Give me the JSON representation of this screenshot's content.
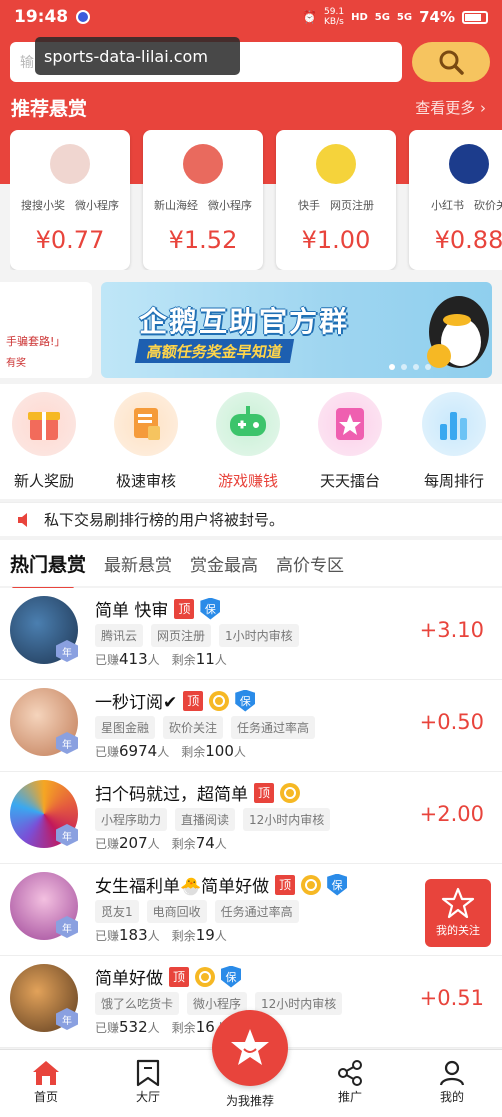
{
  "status": {
    "time": "19:48",
    "net_speed_top": "59.1",
    "net_speed_unit": "KB/s",
    "hd": "HD",
    "sig1": "5G",
    "sig2": "5G",
    "battery": "74%"
  },
  "watermark": "sports-data-lilai.com",
  "search": {
    "placeholder": "输"
  },
  "recommend": {
    "title": "推荐悬赏",
    "more": "查看更多 ›",
    "cards": [
      {
        "tag1": "搜搜小奖",
        "tag2": "微小程序",
        "price": "¥0.77",
        "avatar_color": "#f0d6d0"
      },
      {
        "tag1": "新山海经",
        "tag2": "微小程序",
        "price": "¥1.52",
        "avatar_color": "#e96a5e"
      },
      {
        "tag1": "快手",
        "tag2": "网页注册",
        "price": "¥1.00",
        "avatar_color": "#f5d33b"
      },
      {
        "tag1": "小红书",
        "tag2": "砍价关",
        "price": "¥0.88",
        "avatar_color": "#1c3c8c"
      }
    ]
  },
  "banner": {
    "left_line1": "手骗套路!」",
    "left_line2": "有奖",
    "title": "企鹅互助官方群",
    "subtitle": "高额任务奖金早知道"
  },
  "quick": [
    {
      "label": "新人奖励",
      "color": "#f26b5b"
    },
    {
      "label": "极速审核",
      "color": "#f59b3a"
    },
    {
      "label": "游戏赚钱",
      "color": "#3cc46b"
    },
    {
      "label": "天天擂台",
      "color": "#ef5fb0"
    },
    {
      "label": "每周排行",
      "color": "#3aa8f0"
    }
  ],
  "notice": "私下交易刷排行榜的用户将被封号。",
  "tabs": [
    "热门悬赏",
    "最新悬赏",
    "赏金最高",
    "高价专区"
  ],
  "tasks": [
    {
      "title": "简单 快审",
      "badges": [
        "ding",
        "bao"
      ],
      "tags": [
        "腾讯云",
        "网页注册",
        "1小时内审核"
      ],
      "earned_label": "已赚",
      "earned": "413",
      "people": "人",
      "left_label": "剩余",
      "left": "11",
      "reward": "+3.10",
      "year": "年",
      "avatar_color": "#2a4f7a"
    },
    {
      "title": "一秒订阅✔",
      "badges": [
        "ding",
        "coin",
        "bao"
      ],
      "tags": [
        "星图金融",
        "砍价关注",
        "任务通过率高"
      ],
      "earned_label": "已赚",
      "earned": "6974",
      "people": "人",
      "left_label": "剩余",
      "left": "100",
      "reward": "+0.50",
      "year": "年",
      "avatar_color": "#e8b89a"
    },
    {
      "title": "扫个码就过，超简单",
      "badges": [
        "ding",
        "coin"
      ],
      "tags": [
        "小程序助力",
        "直播阅读",
        "12小时内审核"
      ],
      "earned_label": "已赚",
      "earned": "207",
      "people": "人",
      "left_label": "剩余",
      "left": "74",
      "reward": "+2.00",
      "year": "年",
      "avatar_color": "#e4593f"
    },
    {
      "title": "女生福利单🐣简单好做",
      "badges": [
        "ding",
        "coin",
        "bao"
      ],
      "tags": [
        "觅友1",
        "电商回收",
        "任务通过率高"
      ],
      "earned_label": "已赚",
      "earned": "183",
      "people": "人",
      "left_label": "剩余",
      "left": "19",
      "reward": "",
      "year": "年",
      "avatar_color": "#c85aa8"
    },
    {
      "title": "简单好做",
      "badges": [
        "ding",
        "coin",
        "bao"
      ],
      "tags": [
        "饿了么吃货卡",
        "微小程序",
        "12小时内审核"
      ],
      "earned_label": "已赚",
      "earned": "532",
      "people": "人",
      "left_label": "剩余",
      "left": "16",
      "reward": "+0.51",
      "year": "年",
      "avatar_color": "#7a5a3a"
    }
  ],
  "follow": "我的关注",
  "nav": {
    "home": "首页",
    "hall": "大厅",
    "recommend": "为我推荐",
    "promote": "推广",
    "mine": "我的"
  },
  "colors": {
    "brand": "#e8443c",
    "accent": "#f6c45f"
  }
}
